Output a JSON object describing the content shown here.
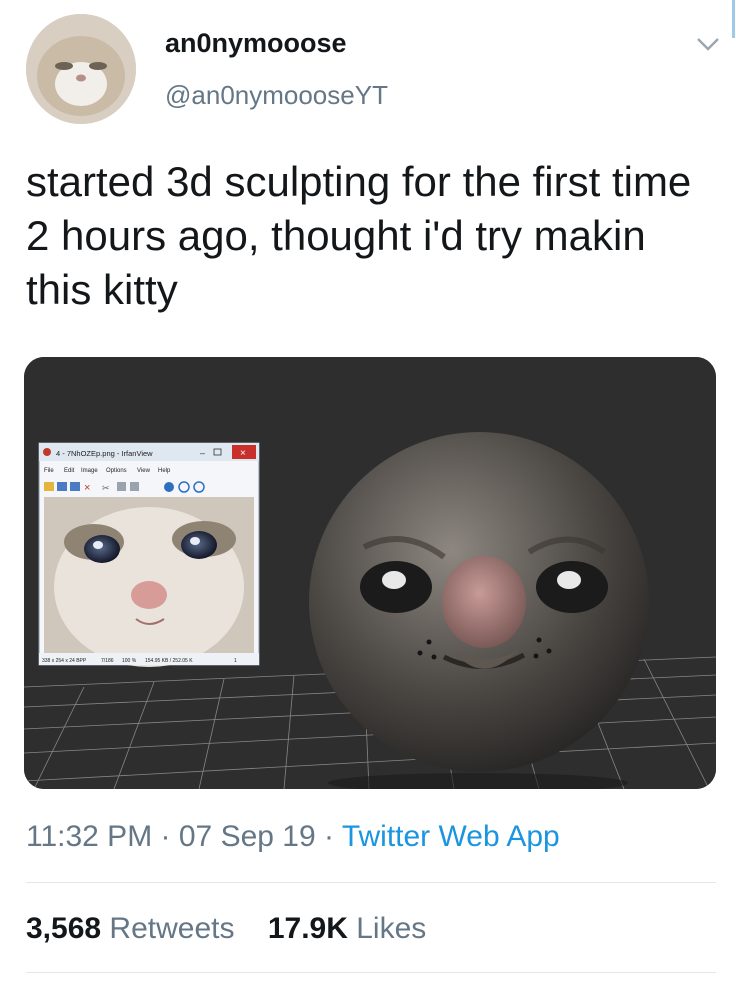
{
  "user": {
    "display_name": "an0nymooose",
    "handle": "@an0nymoooseYT"
  },
  "tweet": {
    "text": "started 3d sculpting for the first time 2 hours ago, thought i'd try makin this kitty",
    "time": "11:32 PM",
    "date": "07 Sep 19",
    "separator": "·",
    "source": "Twitter Web App"
  },
  "stats": {
    "retweets_count": "3,568",
    "retweets_label": "Retweets",
    "likes_count": "17.9K",
    "likes_label": "Likes"
  },
  "media": {
    "irfanview": {
      "title": "4 - 7NhOZEp.png - IrfanView",
      "menu": [
        "File",
        "Edit",
        "Image",
        "Options",
        "View",
        "Help"
      ],
      "status": [
        "338 x 254 x 24 BPP",
        "7/186",
        "100 %",
        "154.95 KB / 252.05 K",
        "1"
      ]
    }
  },
  "icons": {
    "caret": "chevron-down-icon",
    "close": "close-icon"
  },
  "colors": {
    "link": "#1b95e0",
    "muted": "#657786",
    "text": "#14171a",
    "media_bg": "#2f2f2f"
  }
}
